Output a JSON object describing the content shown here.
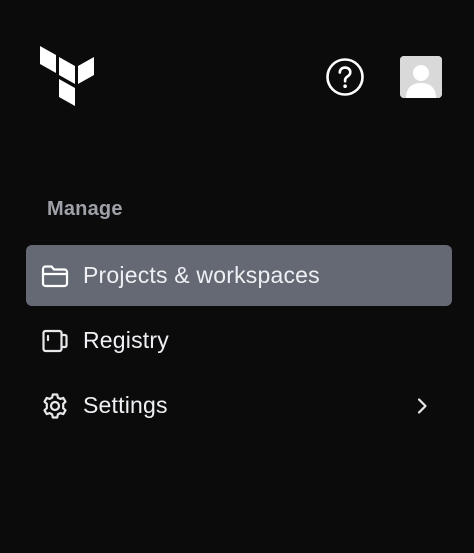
{
  "header": {
    "logo_icon": "terraform-logo-icon",
    "help_icon": "help-circle-icon",
    "avatar_icon": "user-avatar-icon"
  },
  "sidebar": {
    "section_label": "Manage",
    "items": [
      {
        "label": "Projects & workspaces",
        "icon": "folder-icon",
        "active": true
      },
      {
        "label": "Registry",
        "icon": "registry-icon",
        "active": false
      },
      {
        "label": "Settings",
        "icon": "gear-icon",
        "active": false,
        "has_submenu": true
      }
    ]
  },
  "colors": {
    "background": "#0b0b0c",
    "active_item": "#656973",
    "section_label": "#9ea1a8",
    "text": "#eef0f3"
  }
}
